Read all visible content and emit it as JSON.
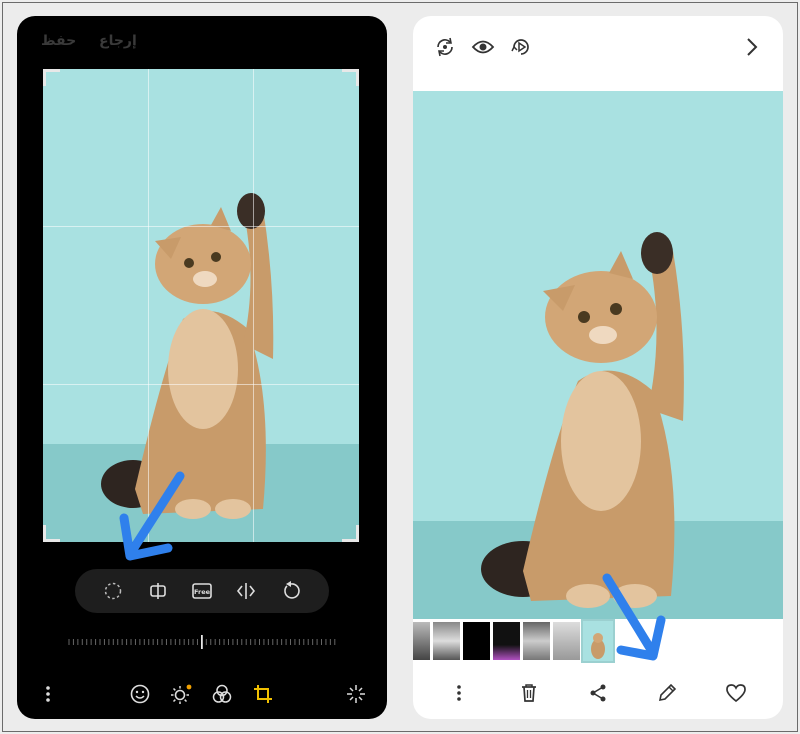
{
  "editor": {
    "save_label": "حفظ",
    "revert_label": "إرجاع",
    "free_label": "Free",
    "tools": [
      {
        "name": "lasso-icon"
      },
      {
        "name": "flip-vertical-icon"
      },
      {
        "name": "free-aspect-icon"
      },
      {
        "name": "mirror-horizontal-icon"
      },
      {
        "name": "rotate-icon"
      }
    ],
    "bottom": [
      {
        "name": "more-options-icon"
      },
      {
        "name": "sticker-face-icon"
      },
      {
        "name": "brightness-icon"
      },
      {
        "name": "filters-icon"
      },
      {
        "name": "crop-rotate-icon"
      },
      {
        "name": "auto-enhance-icon"
      }
    ]
  },
  "viewer": {
    "top": [
      {
        "name": "remaster-icon"
      },
      {
        "name": "eye-icon"
      },
      {
        "name": "motion-photo-icon"
      },
      {
        "name": "chevron-right-icon"
      }
    ],
    "bottom": [
      {
        "name": "more-options-icon"
      },
      {
        "name": "delete-icon"
      },
      {
        "name": "share-icon"
      },
      {
        "name": "edit-pencil-icon"
      },
      {
        "name": "favorite-heart-icon"
      }
    ]
  },
  "colors": {
    "accent_arrow": "#2f80ec",
    "crop_active": "#f0c000",
    "photo_bg": "#a9e1e1"
  }
}
